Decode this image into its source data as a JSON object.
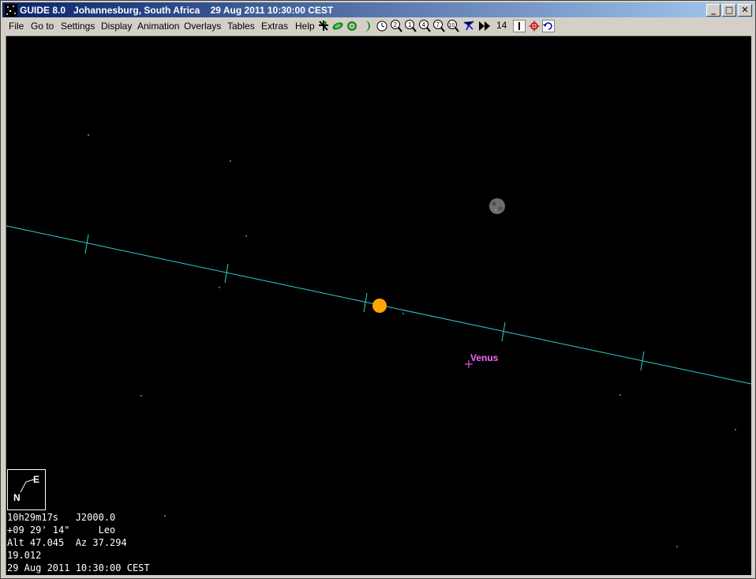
{
  "window": {
    "title": "GUIDE 8.0   Johannesburg, South Africa    29 Aug 2011 10:30:00 CEST",
    "minimize": "_",
    "maximize": "□",
    "close": "✕"
  },
  "menu": [
    "File",
    "Go to",
    "Settings",
    "Display",
    "Animation",
    "Overlays",
    "Tables",
    "Extras",
    "Help"
  ],
  "toolbar": {
    "icons": [
      "toggle-grid-icon",
      "planet-icon",
      "target-icon",
      "moon-icon",
      "clock-icon",
      "zoom-2-icon",
      "zoom-1-icon",
      "zoom-4-icon",
      "zoom-7-icon",
      "zoom-10-icon",
      "star-chart-icon",
      "fast-forward-icon",
      "step-label-icon",
      "step-back-icon",
      "crosshair-icon",
      "undo-icon"
    ],
    "step_label": "14"
  },
  "chart": {
    "objects": {
      "venus_label": "Venus"
    },
    "colors": {
      "ecliptic": "#33cccc",
      "sun": "#ffa500",
      "venus": "#ff66ff",
      "moon": "#808080",
      "background": "#000000"
    }
  },
  "compass": {
    "north": "N",
    "east": "E"
  },
  "info": {
    "ra": "10h29m17s   J2000.0",
    "dec": "+09 29' 14\"     Leo",
    "altaz": "Alt 47.045  Az 37.294",
    "field": "19.012",
    "datetime": "29 Aug 2011 10:30:00 CEST"
  }
}
